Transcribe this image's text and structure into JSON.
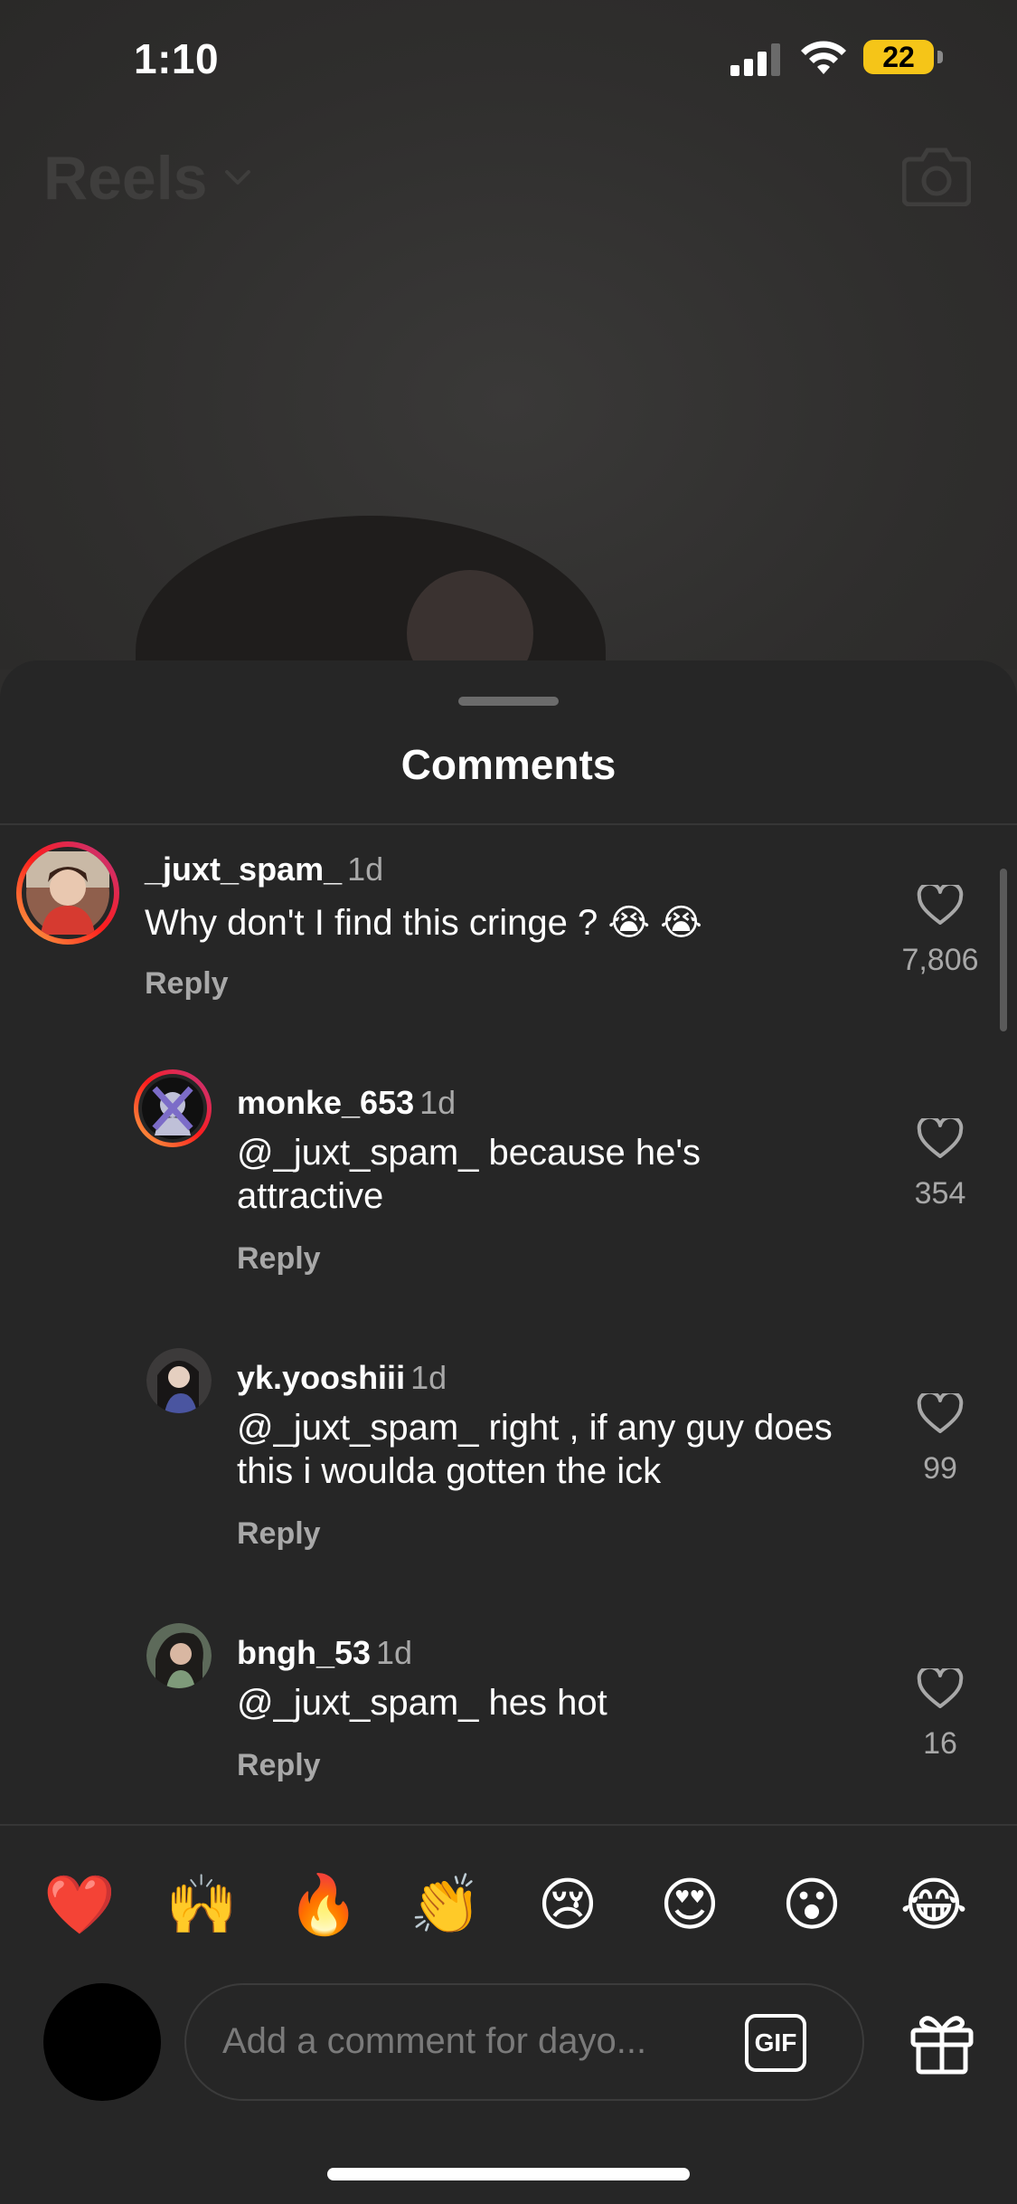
{
  "status_bar": {
    "time": "1:10",
    "battery": "22"
  },
  "header": {
    "title": "Reels"
  },
  "sheet": {
    "title": "Comments"
  },
  "comments": [
    {
      "username": "_juxt_spam_",
      "time": "1d",
      "text": "Why don't I find this cringe ? 😭 😭",
      "reply": "Reply",
      "likes": "7,806"
    },
    {
      "username": "monke_653",
      "time": "1d",
      "text": "@_juxt_spam_ because he's attractive",
      "reply": "Reply",
      "likes": "354"
    },
    {
      "username": "yk.yooshiii",
      "time": "1d",
      "text": "@_juxt_spam_ right , if any guy does this i woulda gotten the ick",
      "reply": "Reply",
      "likes": "99"
    },
    {
      "username": "bngh_53",
      "time": "1d",
      "text": "@_juxt_spam_ hes hot",
      "reply": "Reply",
      "likes": "16"
    }
  ],
  "emoji_bar": [
    "❤️",
    "🙌",
    "🔥",
    "👏",
    "😢",
    "😍",
    "😮",
    "😂"
  ],
  "input": {
    "placeholder": "Add a comment for dayo...",
    "gif_label": "GIF"
  },
  "icons": {
    "heart": "heart-icon",
    "gift": "gift-icon",
    "camera": "camera-icon",
    "chevron": "chevron-down-icon"
  },
  "colors": {
    "battery": "#f5c518",
    "sheet_bg": "#262626",
    "muted_text": "#a8a8a8"
  }
}
